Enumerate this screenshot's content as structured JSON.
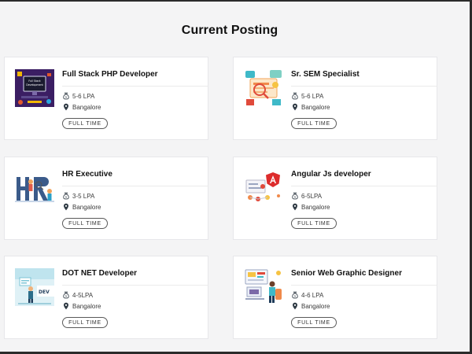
{
  "page": {
    "title": "Current Posting"
  },
  "jobs": [
    {
      "title": "Full Stack PHP Developer",
      "salary": "5-6 LPA",
      "location": "Bangalore",
      "type": "FULL TIME",
      "thumbnail": "full-stack-illustration"
    },
    {
      "title": "Sr. SEM Specialist",
      "salary": "5-6 LPA",
      "location": "Bangalore",
      "type": "FULL TIME",
      "thumbnail": "seo-sem-illustration"
    },
    {
      "title": "HR Executive",
      "salary": "3-5 LPA",
      "location": "Bangalore",
      "type": "FULL TIME",
      "thumbnail": "hr-illustration"
    },
    {
      "title": "Angular Js developer",
      "salary": "6-5LPA",
      "location": "Bangalore",
      "type": "FULL TIME",
      "thumbnail": "angular-illustration"
    },
    {
      "title": "DOT NET Developer",
      "salary": "4-5LPA",
      "location": "Bangalore",
      "type": "FULL TIME",
      "thumbnail": "dotnet-illustration"
    },
    {
      "title": "Senior Web Graphic Designer",
      "salary": "4-6 LPA",
      "location": "Bangalore",
      "type": "FULL TIME",
      "thumbnail": "designer-illustration"
    }
  ],
  "theme": {
    "accent_dark": "#2f3a44",
    "tag_border": "#5a5a5a",
    "background": "#f4f4f5"
  }
}
